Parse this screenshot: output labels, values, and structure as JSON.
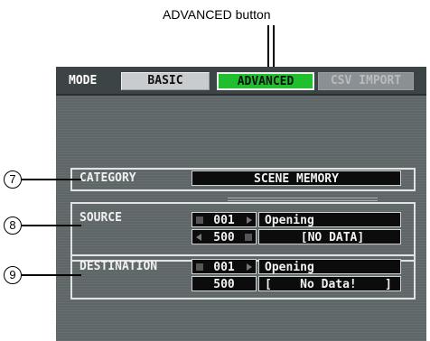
{
  "caption": "ADVANCED button",
  "mode_bar": {
    "label": "MODE",
    "basic": "BASIC",
    "advanced": "ADVANCED",
    "csv_import": "CSV IMPORT"
  },
  "callouts": [
    "7",
    "8",
    "9"
  ],
  "category": {
    "label": "CATEGORY",
    "value": "SCENE MEMORY"
  },
  "source": {
    "label": "SOURCE",
    "row1": {
      "num": "001",
      "name": "Opening"
    },
    "row2": {
      "num": "500",
      "name": "[NO DATA]"
    }
  },
  "destination": {
    "label": "DESTINATION",
    "row1": {
      "num": "001",
      "name": "Opening"
    },
    "row2": {
      "num": "500",
      "name": "[    No Data!    ]"
    }
  },
  "colors": {
    "panel": "#5f6668",
    "modebar": "#3d4446",
    "advanced_active": "#1fbf2e",
    "field": "#0c0c0c"
  }
}
